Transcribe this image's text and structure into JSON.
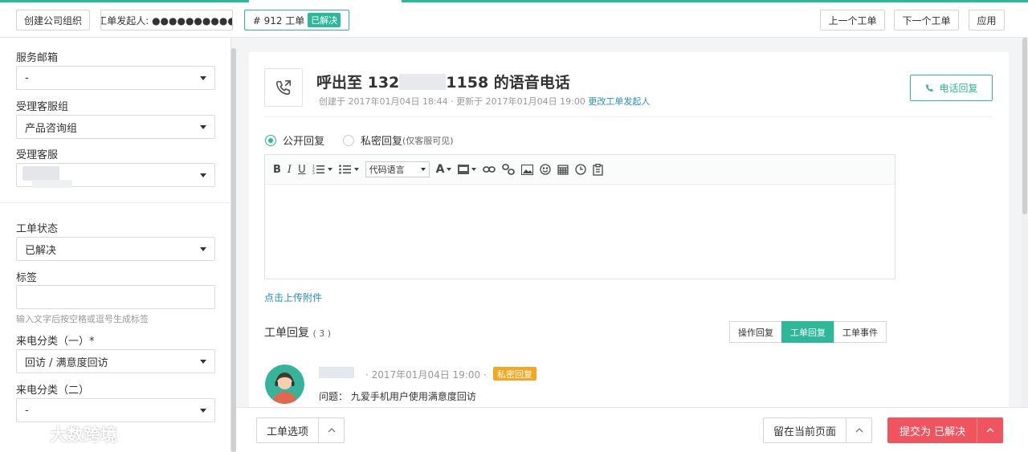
{
  "topbar": {
    "create_org": "创建公司组织",
    "initiator": "工单发起人: ●●●●●●●●●●",
    "ticket_id": "# 912 工单",
    "ticket_status": "已解决",
    "prev": "上一个工单",
    "next": "下一个工单",
    "apply": "应用"
  },
  "sidebar": {
    "service_mailbox": {
      "label": "服务邮箱",
      "value": "-"
    },
    "agent_group": {
      "label": "受理客服组",
      "value": "产品咨询组"
    },
    "agent": {
      "label": "受理客服",
      "value": ""
    },
    "status": {
      "label": "工单状态",
      "value": "已解决"
    },
    "tags": {
      "label": "标签",
      "hint": "输入文字后按空格或逗号生成标签"
    },
    "category1": {
      "label": "来电分类（一）*",
      "value": "回访 / 满意度回访"
    },
    "category2": {
      "label": "来电分类（二）",
      "value": "-"
    }
  },
  "ticket": {
    "title_prefix": "呼出至 132",
    "title_suffix": "1158 的语音电话",
    "created": "创建于 2017年01月04日 18:44",
    "updated": "· 更新于 2017年01月04日 19:00",
    "change_initiator": "更改工单发起人",
    "call_back": "电话回复"
  },
  "reply_mode": {
    "public": "公开回复",
    "private": "私密回复",
    "private_note": "(仅客服可见)"
  },
  "editor": {
    "bold": "B",
    "italic": "I",
    "underline": "U",
    "code_lang": "代码语言",
    "font": "A"
  },
  "upload": "点击上传附件",
  "replies": {
    "title": "工单回复",
    "count": "( 3 )",
    "tabs": [
      "操作回复",
      "工单回复",
      "工单事件"
    ],
    "active_tab": 1,
    "item": {
      "time": "· 2017年01月04日 19:00 ·",
      "badge": "私密回复",
      "body": "问题： 九爱手机用户使用满意度回访"
    }
  },
  "footer": {
    "options": "工单选项",
    "stay": "留在当前页面",
    "submit": "提交为 已解决"
  },
  "watermark": "大数跨境",
  "colors": {
    "accent": "#2eb89a",
    "link": "#2a8fbd",
    "danger": "#f0555f",
    "warning": "#f5a623"
  }
}
